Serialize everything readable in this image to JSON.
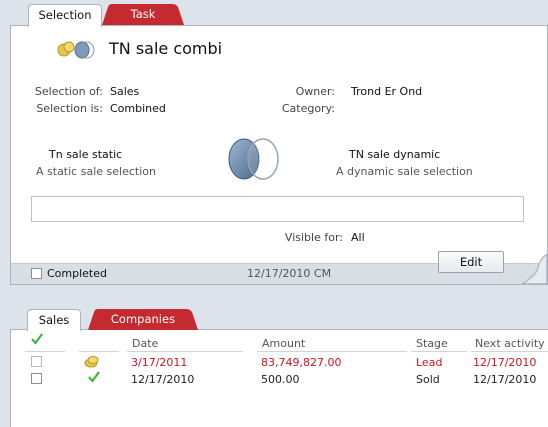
{
  "colors": {
    "accent_red": "#c42a2f",
    "lead_red": "#c8161d",
    "check_green": "#2fb52f"
  },
  "tabs": [
    {
      "label": "Selection",
      "active": true
    },
    {
      "label": "Task",
      "active": false
    }
  ],
  "selection": {
    "title": "TN sale combi",
    "selection_of_label": "Selection of:",
    "selection_of_value": "Sales",
    "selection_is_label": "Selection is:",
    "selection_is_value": "Combined",
    "owner_label": "Owner:",
    "owner_value": "Trond Er Ond",
    "category_label": "Category:",
    "category_value": "",
    "left_set": {
      "name": "Tn sale static",
      "description": "A static sale selection"
    },
    "right_set": {
      "name": "TN sale dynamic",
      "description": "A dynamic sale selection"
    },
    "description_value": "",
    "visible_for_label": "Visible for:",
    "visible_for_value": "All",
    "edit_label": "Edit",
    "completed_label": "Completed",
    "footer_date": "12/17/2010 CM"
  },
  "bottom_tabs": [
    {
      "label": "Sales",
      "active": true
    },
    {
      "label": "Companies",
      "active": false
    }
  ],
  "table": {
    "columns": [
      "Date",
      "Amount",
      "Stage",
      "Next activity"
    ],
    "rows": [
      {
        "icon": "coins-icon",
        "date": "3/17/2011",
        "amount": "83,749,827.00",
        "stage": "Lead",
        "next_activity": "12/17/2010",
        "highlight": true
      },
      {
        "icon": "check-icon",
        "date": "12/17/2010",
        "amount": "500.00",
        "stage": "Sold",
        "next_activity": "12/17/2010",
        "highlight": false
      }
    ]
  }
}
